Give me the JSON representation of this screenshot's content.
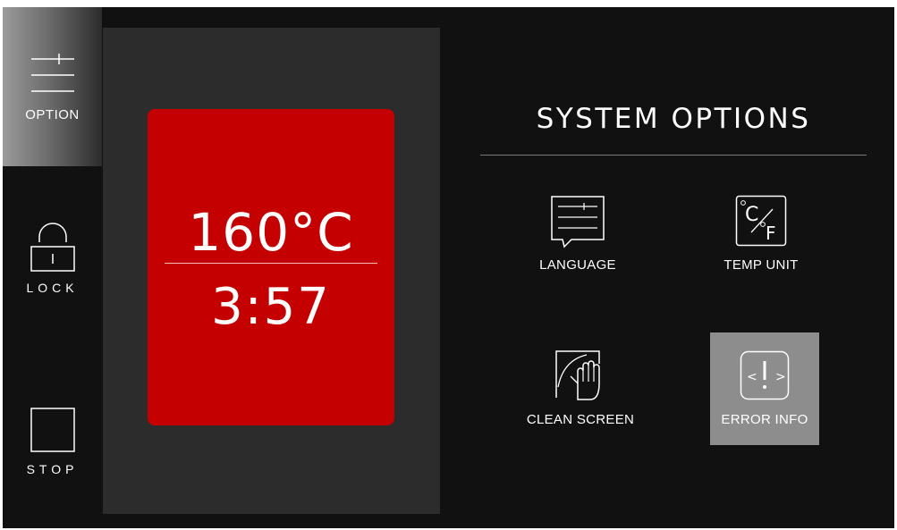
{
  "sidebar": {
    "items": [
      {
        "label": "OPTION",
        "icon": "menu-lines-icon",
        "active": true
      },
      {
        "label": "LOCK",
        "icon": "padlock-icon",
        "active": false
      },
      {
        "label": "STOP",
        "icon": "stop-square-icon",
        "active": false
      }
    ]
  },
  "oven": {
    "temperature": "160",
    "temperature_unit": "°C",
    "time": "3:57",
    "card_color": "#c40000"
  },
  "system_options": {
    "title": "SYSTEM OPTIONS",
    "items": [
      {
        "label": "LANGUAGE",
        "icon": "language-speech-icon",
        "selected": false
      },
      {
        "label": "TEMP UNIT",
        "icon": "celsius-fahrenheit-icon",
        "selected": false
      },
      {
        "label": "CLEAN SCREEN",
        "icon": "clean-screen-hand-icon",
        "selected": false
      },
      {
        "label": "ERROR INFO",
        "icon": "error-exclamation-icon",
        "selected": true
      }
    ]
  },
  "colors": {
    "background": "#111111",
    "panel": "#2c2c2c",
    "accent_red": "#c40000",
    "selected_tile": "#8d8d8d"
  }
}
